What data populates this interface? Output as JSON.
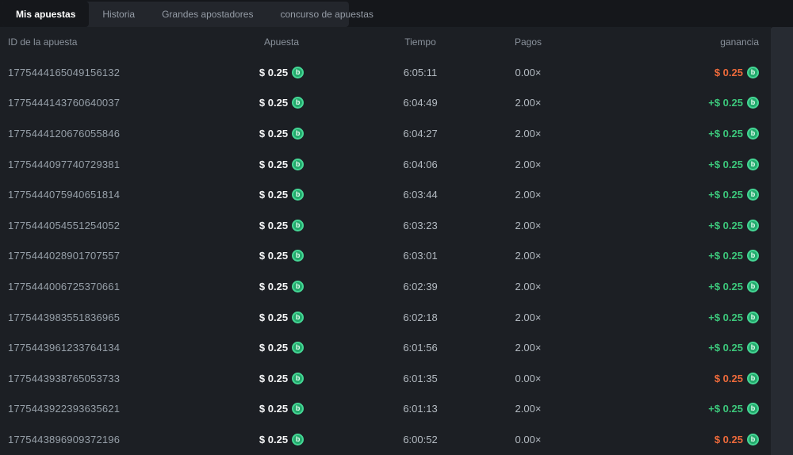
{
  "tabs": [
    {
      "label": "Mis apuestas",
      "active": true
    },
    {
      "label": "Historia",
      "active": false
    },
    {
      "label": "Grandes apostadores",
      "active": false
    },
    {
      "label": "concurso de apuestas",
      "active": false
    }
  ],
  "table": {
    "columns": [
      "ID de la apuesta",
      "Apuesta",
      "Tiempo",
      "Pagos",
      "ganancia"
    ],
    "rows": [
      {
        "id": "1775444165049156132",
        "bet": "$ 0.25",
        "time": "6:05:11",
        "payout": "0.00×",
        "profit": "$ 0.25",
        "result": "loss"
      },
      {
        "id": "1775444143760640037",
        "bet": "$ 0.25",
        "time": "6:04:49",
        "payout": "2.00×",
        "profit": "+$ 0.25",
        "result": "win"
      },
      {
        "id": "1775444120676055846",
        "bet": "$ 0.25",
        "time": "6:04:27",
        "payout": "2.00×",
        "profit": "+$ 0.25",
        "result": "win"
      },
      {
        "id": "1775444097740729381",
        "bet": "$ 0.25",
        "time": "6:04:06",
        "payout": "2.00×",
        "profit": "+$ 0.25",
        "result": "win"
      },
      {
        "id": "1775444075940651814",
        "bet": "$ 0.25",
        "time": "6:03:44",
        "payout": "2.00×",
        "profit": "+$ 0.25",
        "result": "win"
      },
      {
        "id": "1775444054551254052",
        "bet": "$ 0.25",
        "time": "6:03:23",
        "payout": "2.00×",
        "profit": "+$ 0.25",
        "result": "win"
      },
      {
        "id": "1775444028901707557",
        "bet": "$ 0.25",
        "time": "6:03:01",
        "payout": "2.00×",
        "profit": "+$ 0.25",
        "result": "win"
      },
      {
        "id": "1775444006725370661",
        "bet": "$ 0.25",
        "time": "6:02:39",
        "payout": "2.00×",
        "profit": "+$ 0.25",
        "result": "win"
      },
      {
        "id": "1775443983551836965",
        "bet": "$ 0.25",
        "time": "6:02:18",
        "payout": "2.00×",
        "profit": "+$ 0.25",
        "result": "win"
      },
      {
        "id": "1775443961233764134",
        "bet": "$ 0.25",
        "time": "6:01:56",
        "payout": "2.00×",
        "profit": "+$ 0.25",
        "result": "win"
      },
      {
        "id": "1775443938765053733",
        "bet": "$ 0.25",
        "time": "6:01:35",
        "payout": "0.00×",
        "profit": "$ 0.25",
        "result": "loss"
      },
      {
        "id": "1775443922393635621",
        "bet": "$ 0.25",
        "time": "6:01:13",
        "payout": "2.00×",
        "profit": "+$ 0.25",
        "result": "win"
      },
      {
        "id": "1775443896909372196",
        "bet": "$ 0.25",
        "time": "6:00:52",
        "payout": "0.00×",
        "profit": "$ 0.25",
        "result": "loss"
      }
    ]
  },
  "icons": {
    "coin": "b"
  },
  "colors": {
    "win_green": "#3cc77b",
    "loss_orange": "#ed6a3b",
    "coin_green": "#23a96c"
  }
}
